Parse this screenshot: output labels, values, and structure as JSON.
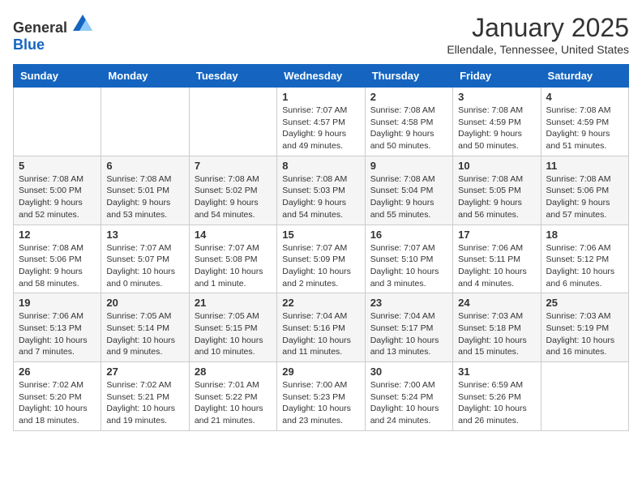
{
  "header": {
    "logo_general": "General",
    "logo_blue": "Blue",
    "title": "January 2025",
    "subtitle": "Ellendale, Tennessee, United States"
  },
  "days_of_week": [
    "Sunday",
    "Monday",
    "Tuesday",
    "Wednesday",
    "Thursday",
    "Friday",
    "Saturday"
  ],
  "weeks": [
    [
      {
        "day": "",
        "info": ""
      },
      {
        "day": "",
        "info": ""
      },
      {
        "day": "",
        "info": ""
      },
      {
        "day": "1",
        "info": "Sunrise: 7:07 AM\nSunset: 4:57 PM\nDaylight: 9 hours\nand 49 minutes."
      },
      {
        "day": "2",
        "info": "Sunrise: 7:08 AM\nSunset: 4:58 PM\nDaylight: 9 hours\nand 50 minutes."
      },
      {
        "day": "3",
        "info": "Sunrise: 7:08 AM\nSunset: 4:59 PM\nDaylight: 9 hours\nand 50 minutes."
      },
      {
        "day": "4",
        "info": "Sunrise: 7:08 AM\nSunset: 4:59 PM\nDaylight: 9 hours\nand 51 minutes."
      }
    ],
    [
      {
        "day": "5",
        "info": "Sunrise: 7:08 AM\nSunset: 5:00 PM\nDaylight: 9 hours\nand 52 minutes."
      },
      {
        "day": "6",
        "info": "Sunrise: 7:08 AM\nSunset: 5:01 PM\nDaylight: 9 hours\nand 53 minutes."
      },
      {
        "day": "7",
        "info": "Sunrise: 7:08 AM\nSunset: 5:02 PM\nDaylight: 9 hours\nand 54 minutes."
      },
      {
        "day": "8",
        "info": "Sunrise: 7:08 AM\nSunset: 5:03 PM\nDaylight: 9 hours\nand 54 minutes."
      },
      {
        "day": "9",
        "info": "Sunrise: 7:08 AM\nSunset: 5:04 PM\nDaylight: 9 hours\nand 55 minutes."
      },
      {
        "day": "10",
        "info": "Sunrise: 7:08 AM\nSunset: 5:05 PM\nDaylight: 9 hours\nand 56 minutes."
      },
      {
        "day": "11",
        "info": "Sunrise: 7:08 AM\nSunset: 5:06 PM\nDaylight: 9 hours\nand 57 minutes."
      }
    ],
    [
      {
        "day": "12",
        "info": "Sunrise: 7:08 AM\nSunset: 5:06 PM\nDaylight: 9 hours\nand 58 minutes."
      },
      {
        "day": "13",
        "info": "Sunrise: 7:07 AM\nSunset: 5:07 PM\nDaylight: 10 hours\nand 0 minutes."
      },
      {
        "day": "14",
        "info": "Sunrise: 7:07 AM\nSunset: 5:08 PM\nDaylight: 10 hours\nand 1 minute."
      },
      {
        "day": "15",
        "info": "Sunrise: 7:07 AM\nSunset: 5:09 PM\nDaylight: 10 hours\nand 2 minutes."
      },
      {
        "day": "16",
        "info": "Sunrise: 7:07 AM\nSunset: 5:10 PM\nDaylight: 10 hours\nand 3 minutes."
      },
      {
        "day": "17",
        "info": "Sunrise: 7:06 AM\nSunset: 5:11 PM\nDaylight: 10 hours\nand 4 minutes."
      },
      {
        "day": "18",
        "info": "Sunrise: 7:06 AM\nSunset: 5:12 PM\nDaylight: 10 hours\nand 6 minutes."
      }
    ],
    [
      {
        "day": "19",
        "info": "Sunrise: 7:06 AM\nSunset: 5:13 PM\nDaylight: 10 hours\nand 7 minutes."
      },
      {
        "day": "20",
        "info": "Sunrise: 7:05 AM\nSunset: 5:14 PM\nDaylight: 10 hours\nand 9 minutes."
      },
      {
        "day": "21",
        "info": "Sunrise: 7:05 AM\nSunset: 5:15 PM\nDaylight: 10 hours\nand 10 minutes."
      },
      {
        "day": "22",
        "info": "Sunrise: 7:04 AM\nSunset: 5:16 PM\nDaylight: 10 hours\nand 11 minutes."
      },
      {
        "day": "23",
        "info": "Sunrise: 7:04 AM\nSunset: 5:17 PM\nDaylight: 10 hours\nand 13 minutes."
      },
      {
        "day": "24",
        "info": "Sunrise: 7:03 AM\nSunset: 5:18 PM\nDaylight: 10 hours\nand 15 minutes."
      },
      {
        "day": "25",
        "info": "Sunrise: 7:03 AM\nSunset: 5:19 PM\nDaylight: 10 hours\nand 16 minutes."
      }
    ],
    [
      {
        "day": "26",
        "info": "Sunrise: 7:02 AM\nSunset: 5:20 PM\nDaylight: 10 hours\nand 18 minutes."
      },
      {
        "day": "27",
        "info": "Sunrise: 7:02 AM\nSunset: 5:21 PM\nDaylight: 10 hours\nand 19 minutes."
      },
      {
        "day": "28",
        "info": "Sunrise: 7:01 AM\nSunset: 5:22 PM\nDaylight: 10 hours\nand 21 minutes."
      },
      {
        "day": "29",
        "info": "Sunrise: 7:00 AM\nSunset: 5:23 PM\nDaylight: 10 hours\nand 23 minutes."
      },
      {
        "day": "30",
        "info": "Sunrise: 7:00 AM\nSunset: 5:24 PM\nDaylight: 10 hours\nand 24 minutes."
      },
      {
        "day": "31",
        "info": "Sunrise: 6:59 AM\nSunset: 5:26 PM\nDaylight: 10 hours\nand 26 minutes."
      },
      {
        "day": "",
        "info": ""
      }
    ]
  ]
}
